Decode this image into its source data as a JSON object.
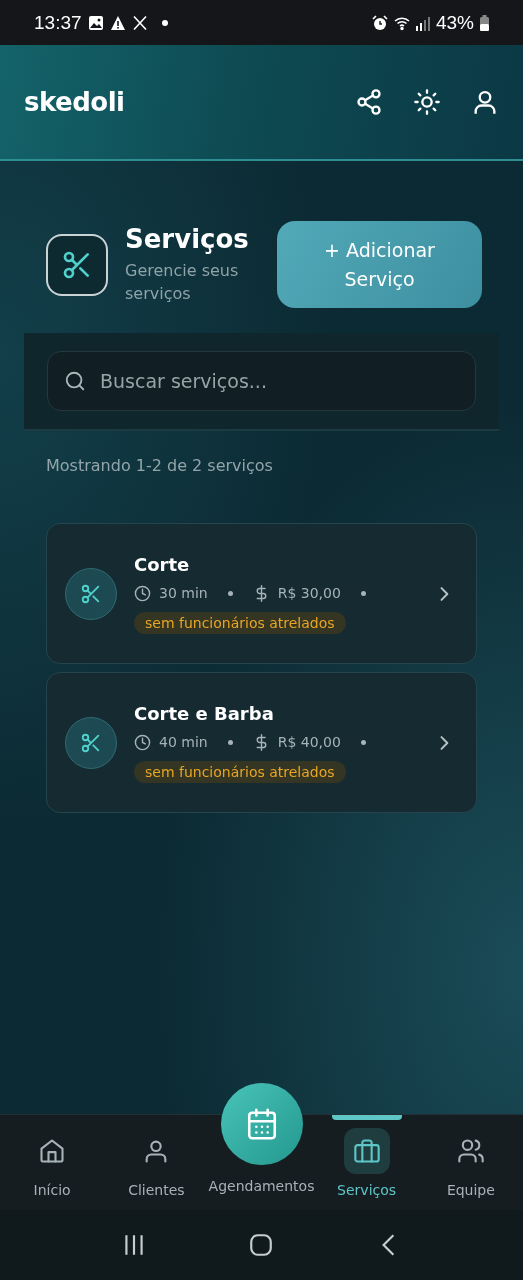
{
  "status_bar": {
    "time": "13:37",
    "battery": "43%"
  },
  "header": {
    "logo": "skedoli"
  },
  "page": {
    "title": "Serviços",
    "subtitle": "Gerencie seus serviços",
    "add_button": "+ Adicionar Serviço"
  },
  "search": {
    "placeholder": "Buscar serviços..."
  },
  "count": "Mostrando 1-2 de 2 serviços",
  "services": [
    {
      "name": "Corte",
      "duration": "30 min",
      "price": "R$ 30,00",
      "badge": "sem funcionários atrelados"
    },
    {
      "name": "Corte e Barba",
      "duration": "40 min",
      "price": "R$ 40,00",
      "badge": "sem funcionários atrelados"
    }
  ],
  "bottom_nav": [
    {
      "label": "Início",
      "kind": "home",
      "selected": false
    },
    {
      "label": "Clientes",
      "kind": "person",
      "selected": false
    },
    {
      "label": "Agendamentos",
      "kind": "calendar",
      "selected": false
    },
    {
      "label": "Serviços",
      "kind": "briefcase",
      "selected": true
    },
    {
      "label": "Equipe",
      "kind": "team",
      "selected": false
    }
  ]
}
